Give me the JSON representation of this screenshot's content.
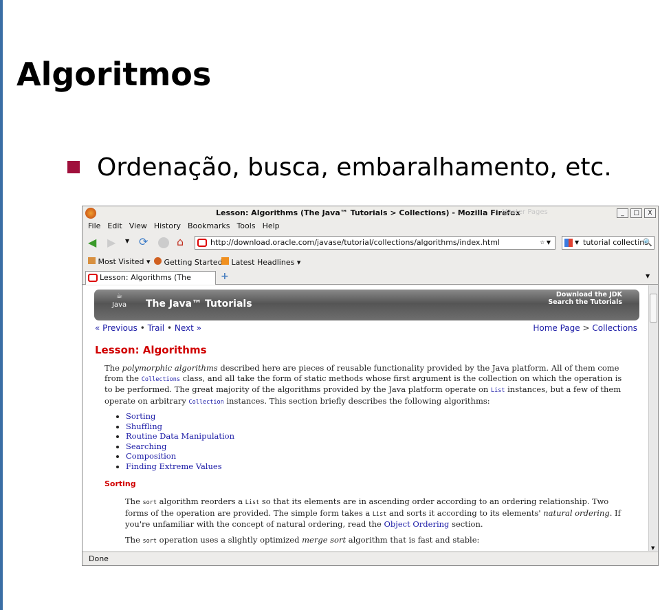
{
  "slide": {
    "title": "Algoritmos",
    "bullet": "Ordenação, busca, embaralhamento, etc.",
    "bullet_color": "#a0103c"
  },
  "window": {
    "title": "Lesson: Algorithms (The Java™ Tutorials > Collections) - Mozilla Firefox",
    "ghost_text": "Master Pages",
    "min": "_",
    "max": "□",
    "close": "X"
  },
  "menu": [
    "File",
    "Edit",
    "View",
    "History",
    "Bookmarks",
    "Tools",
    "Help"
  ],
  "url": "http://download.oracle.com/javase/tutorial/collections/algorithms/index.html",
  "search": "tutorial collectins",
  "bookmarks": [
    "Most Visited",
    "Getting Started",
    "Latest Headlines"
  ],
  "tab": {
    "label": "Lesson: Algorithms (The Java™ ...",
    "new_tab": "+"
  },
  "page": {
    "banner_title": "The Java™ Tutorials",
    "java_logo": "Java",
    "download": "Download the JDK",
    "search": "Search the Tutorials",
    "nav": {
      "previous": "« Previous",
      "sep": "•",
      "trail": "Trail",
      "next": "Next »",
      "home": "Home Page",
      "gt": ">",
      "collections": "Collections"
    },
    "heading": "Lesson: Algorithms",
    "p1": {
      "a": "The ",
      "em": "polymorphic algorithms",
      "b": " described here are pieces of reusable functionality provided by the Java platform. All of them come from the ",
      "code1": "Collections",
      "c": " class, and all take the form of static methods whose first argument is the collection on which the operation is to be performed. The great majority of the algorithms provided by the Java platform operate on ",
      "code2": "List",
      "d": " instances, but a few of them operate on arbitrary ",
      "code3": "Collection",
      "e": " instances. This section briefly describes the following algorithms:"
    },
    "list": [
      "Sorting",
      "Shuffling",
      "Routine Data Manipulation",
      "Searching",
      "Composition",
      "Finding Extreme Values"
    ],
    "sorting_heading": "Sorting",
    "p2": {
      "a": "The ",
      "code1": "sort",
      "b": " algorithm reorders a ",
      "code2": "List",
      "c": " so that its elements are in ascending order according to an ordering relationship. Two forms of the operation are provided. The simple form takes a ",
      "code3": "List",
      "d": " and sorts it according to its elements' ",
      "em": "natural ordering",
      "e": ". If you're unfamiliar with the concept of natural ordering, read the ",
      "link": "Object Ordering",
      "f": " section."
    },
    "p3": {
      "a": "The ",
      "code": "sort",
      "b": " operation uses a slightly optimized ",
      "em": "merge sort",
      "c": " algorithm that is fast and stable:"
    }
  },
  "status": "Done"
}
